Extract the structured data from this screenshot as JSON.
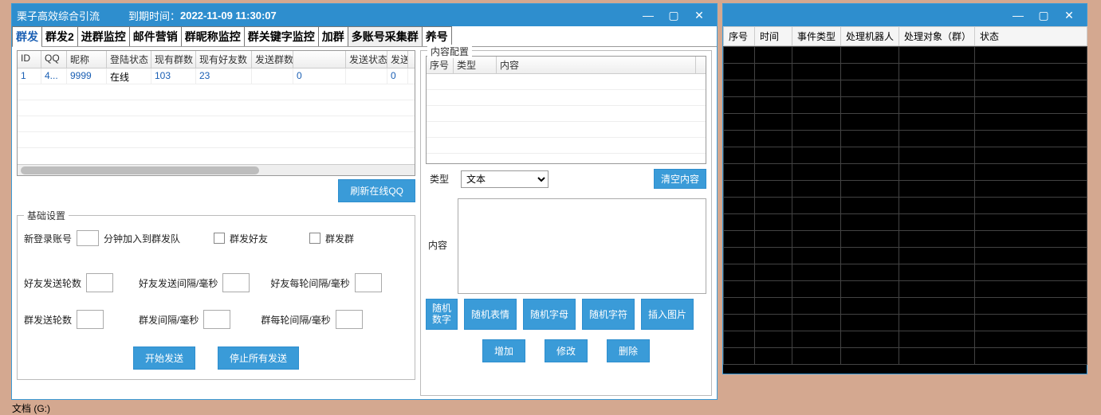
{
  "window1": {
    "title": "栗子高效综合引流",
    "expire_label": "到期时间：",
    "expire_value": "2022-11-09 11:30:07",
    "tabs": [
      "群发",
      "群发2",
      "进群监控",
      "邮件营销",
      "群昵称监控",
      "群关键字监控",
      "加群",
      "多账号采集群",
      "养号"
    ],
    "accounts_table": {
      "headers": [
        "ID",
        "QQ",
        "昵称",
        "登陆状态",
        "现有群数",
        "现有好友数",
        "发送群数",
        "发送状态",
        "发送"
      ],
      "row": {
        "id": "1",
        "qq": "4...",
        "nick": "9999",
        "login": "在线",
        "groups": "103",
        "friends": "23",
        "sendg": "",
        "count": "0",
        "status": "",
        "sf": "0"
      }
    },
    "refresh_btn": "刷新在线QQ",
    "basic_settings": {
      "legend": "基础设置",
      "new_login_label": "新登录账号",
      "minutes_label": "分钟加入到群发队",
      "send_friends": "群发好友",
      "send_groups": "群发群",
      "friend_rounds": "好友发送轮数",
      "friend_interval": "好友发送间隔/毫秒",
      "friend_round_interval": "好友每轮间隔/毫秒",
      "group_rounds": "群发送轮数",
      "group_interval": "群发间隔/毫秒",
      "group_round_interval": "群每轮间隔/毫秒",
      "start_btn": "开始发送",
      "stop_btn": "停止所有发送"
    },
    "content_config": {
      "legend": "内容配置",
      "headers": [
        "序号",
        "类型",
        "内容"
      ],
      "type_label": "类型",
      "type_value": "文本",
      "clear_btn": "清空内容",
      "content_label": "内容",
      "rand_num": "随机数字",
      "rand_emoji": "随机表情",
      "rand_letter": "随机字母",
      "rand_char": "随机字符",
      "insert_img": "插入图片",
      "add_btn": "增加",
      "edit_btn": "修改",
      "del_btn": "删除"
    }
  },
  "window2": {
    "headers": [
      "序号",
      "时间",
      "事件类型",
      "处理机器人",
      "处理对象（群）",
      "状态"
    ]
  },
  "desktop_label": "文档 (G:)"
}
